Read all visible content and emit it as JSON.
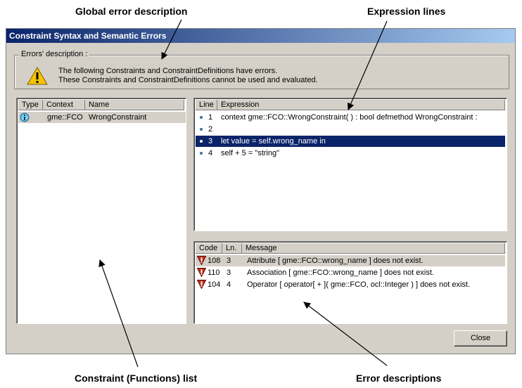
{
  "annotations": {
    "global_error": "Global error description",
    "expression_lines": "Expression lines",
    "constraint_list": "Constraint (Functions) list",
    "error_descriptions": "Error descriptions"
  },
  "window": {
    "title": "Constraint Syntax and Semantic Errors",
    "group_label": "Errors' description :",
    "message_line1": "The following Constraints and ConstraintDefinitions have errors.",
    "message_line2": "These Constraints and ConstraintDefinitions cannot be used and evaluated.",
    "close_label": "Close"
  },
  "constraints": {
    "columns": [
      "Type",
      "Context",
      "Name"
    ],
    "rows": [
      {
        "type_icon": "info-icon",
        "context": "gme::FCO",
        "name": "WrongConstraint"
      }
    ]
  },
  "expressions": {
    "columns": [
      "Line",
      "Expression"
    ],
    "rows": [
      {
        "line": "1",
        "text": "context gme::FCO::WrongConstraint(  ) : bool defmethod WrongConstraint :"
      },
      {
        "line": "2",
        "text": ""
      },
      {
        "line": "3",
        "text": "let value = self.wrong_name in",
        "selected": true
      },
      {
        "line": "4",
        "text": "self + 5 = \"string\""
      }
    ]
  },
  "errors": {
    "columns": [
      "Code",
      "Ln.",
      "Message"
    ],
    "rows": [
      {
        "code": "108",
        "ln": "3",
        "message": "Attribute [ gme::FCO::wrong_name ] does not exist."
      },
      {
        "code": "110",
        "ln": "3",
        "message": "Association [ gme::FCO::wrong_name ] does not exist."
      },
      {
        "code": "104",
        "ln": "4",
        "message": "Operator [ operator[ + ]( gme::FCO, ocl::Integer ) ] does not exist."
      }
    ]
  },
  "colors": {
    "selection": "#0a246a",
    "titlebar": "#0a246a",
    "error_icon": "#c03020"
  }
}
